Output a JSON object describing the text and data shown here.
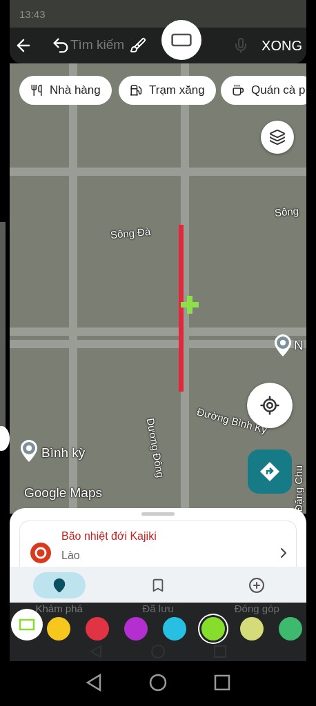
{
  "status_bar": {
    "time": "13:43"
  },
  "markup_toolbar": {
    "tools": [
      {
        "kind": "pen",
        "selected": false
      },
      {
        "kind": "rectangle",
        "selected": true
      }
    ],
    "done_label": "XONG"
  },
  "search": {
    "placeholder": "Tìm kiếm"
  },
  "chips": [
    {
      "kind": "restaurant",
      "label": "Nhà hàng"
    },
    {
      "kind": "gas",
      "label": "Trạm xăng"
    },
    {
      "kind": "cafe",
      "label": "Quán cà p"
    }
  ],
  "map": {
    "labels": [
      {
        "kind": "street",
        "text": "Sông Đà"
      },
      {
        "kind": "street",
        "text": "Sông"
      },
      {
        "kind": "place",
        "text": "N"
      },
      {
        "kind": "street",
        "text": "Đường Bình Kỳ"
      },
      {
        "kind": "street",
        "text": "Dương Đông"
      },
      {
        "kind": "place",
        "text": "Bình kỳ"
      },
      {
        "kind": "street",
        "text": "Đặng Chu"
      }
    ],
    "brand": "Google Maps"
  },
  "alert_card": {
    "title": "Bão nhiệt đới Kajiki",
    "subtitle": "Lào"
  },
  "bottom_nav": [
    {
      "kind": "explore",
      "label": "Khám phá",
      "selected": true
    },
    {
      "kind": "saved",
      "label": "Đã lưu",
      "selected": false
    },
    {
      "kind": "contribute",
      "label": "Đóng góp",
      "selected": false
    }
  ],
  "palette": [
    {
      "color": "#f6c81e",
      "selected": false
    },
    {
      "color": "#e03444",
      "selected": false
    },
    {
      "color": "#b32fcf",
      "selected": false
    },
    {
      "color": "#27c0e3",
      "selected": false
    },
    {
      "color": "#86dd2c",
      "selected": true
    },
    {
      "color": "#d4db78",
      "selected": false
    },
    {
      "color": "#3dba6e",
      "selected": false
    }
  ]
}
